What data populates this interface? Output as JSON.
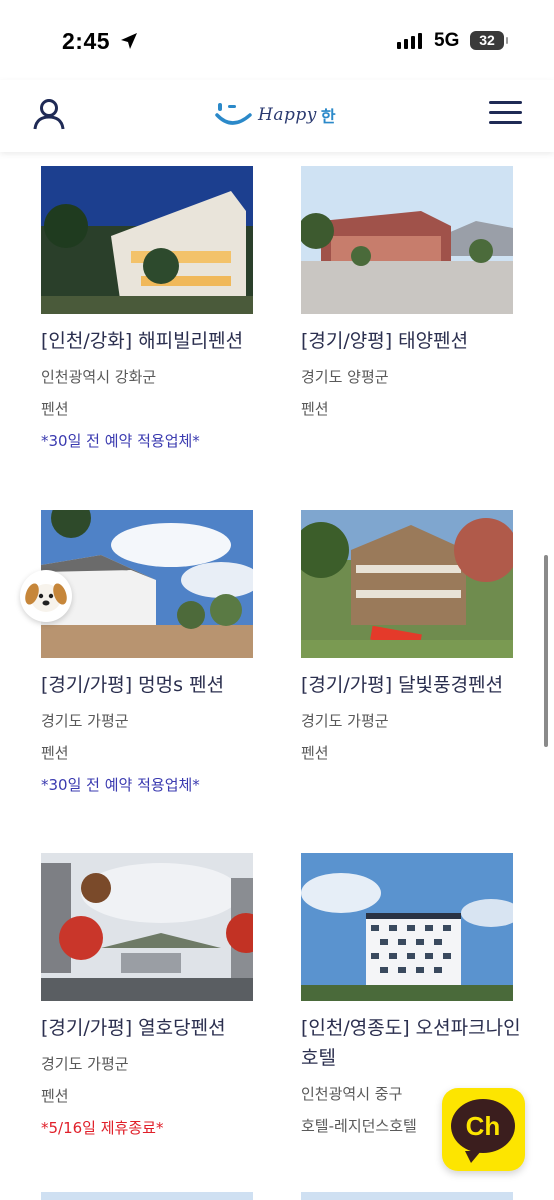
{
  "status_bar": {
    "time": "2:45",
    "network": "5G",
    "battery": "32"
  },
  "header": {
    "logo_text": "Happy",
    "logo_suffix": "한"
  },
  "listings": [
    {
      "title": "[인천/강화] 해피빌리펜션",
      "region": "인천광역시 강화군",
      "type": "펜션",
      "note": "*30일 전 예약 적용업체*",
      "note_color": "#3b3bb0"
    },
    {
      "title": "[경기/양평] 태양펜션",
      "region": "경기도 양평군",
      "type": "펜션",
      "note": ""
    },
    {
      "title": "[경기/가평] 멍멍s 펜션",
      "region": "경기도 가평군",
      "type": "펜션",
      "note": "*30일 전 예약 적용업체*",
      "note_color": "#3b3bb0"
    },
    {
      "title": "[경기/가평] 달빛풍경펜션",
      "region": "경기도 가평군",
      "type": "펜션",
      "note": ""
    },
    {
      "title": "[경기/가평] 열호당펜션",
      "region": "경기도 가평군",
      "type": "펜션",
      "note": "*5/16일 제휴종료*",
      "note_color": "#e0202a"
    },
    {
      "title": "[인천/영종도] 오션파크나인호텔",
      "region": "인천광역시 중구",
      "type": "호텔-레지던스호텔",
      "note": ""
    }
  ],
  "floating": {
    "kakao_label": "Ch"
  },
  "icons": {
    "user": "user-icon",
    "menu": "hamburger-menu-icon",
    "dog": "dog-mascot-icon",
    "kakao": "kakao-channel-icon"
  }
}
